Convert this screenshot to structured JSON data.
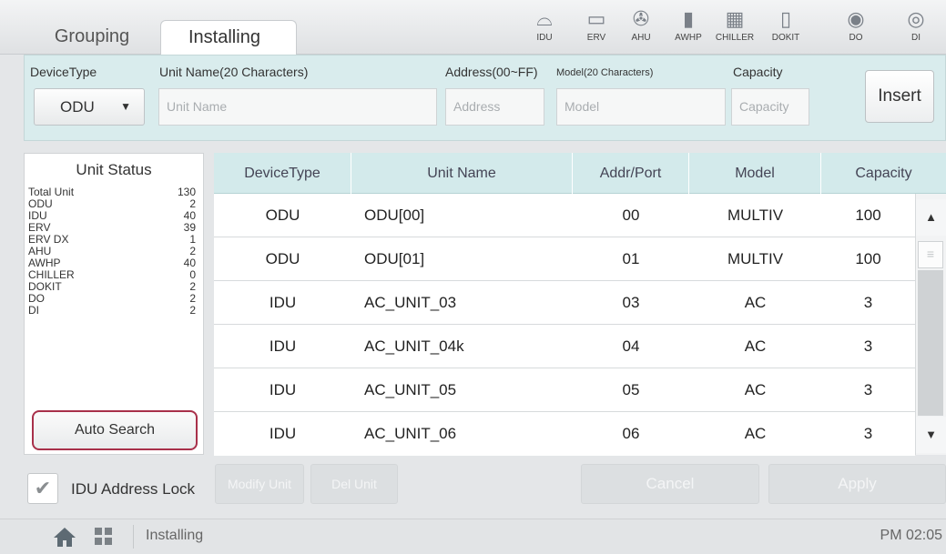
{
  "tabs": [
    {
      "label": "Grouping"
    },
    {
      "label": "Installing"
    }
  ],
  "device_icons": [
    {
      "label": "IDU",
      "icon": "idu-icon"
    },
    {
      "label": "ERV",
      "icon": "erv-icon"
    },
    {
      "label": "AHU",
      "icon": "ahu-icon"
    },
    {
      "label": "AWHP",
      "icon": "awhp-icon"
    },
    {
      "label": "CHILLER",
      "icon": "chiller-icon"
    },
    {
      "label": "DOKIT",
      "icon": "dokit-icon"
    },
    {
      "label": "DO",
      "icon": "do-icon"
    },
    {
      "label": "DI",
      "icon": "di-icon"
    }
  ],
  "form": {
    "device_type_label": "DeviceType",
    "device_type_value": "ODU",
    "unit_name_label": "Unit Name(20 Characters)",
    "unit_name_placeholder": "Unit Name",
    "address_label": "Address(00~FF)",
    "address_placeholder": "Address",
    "model_label": "Model(20 Characters)",
    "model_placeholder": "Model",
    "capacity_label": "Capacity",
    "capacity_placeholder": "Capacity",
    "insert_label": "Insert"
  },
  "unit_status": {
    "title": "Unit Status",
    "rows": [
      {
        "name": "Total Unit",
        "count": "130"
      },
      {
        "name": "ODU",
        "count": "2"
      },
      {
        "name": "IDU",
        "count": "40"
      },
      {
        "name": "ERV",
        "count": "39"
      },
      {
        "name": "ERV DX",
        "count": "1"
      },
      {
        "name": "AHU",
        "count": "2"
      },
      {
        "name": "AWHP",
        "count": "40"
      },
      {
        "name": "CHILLER",
        "count": "0"
      },
      {
        "name": "DOKIT",
        "count": "2"
      },
      {
        "name": "DO",
        "count": "2"
      },
      {
        "name": "DI",
        "count": "2"
      }
    ],
    "auto_search_label": "Auto Search"
  },
  "table": {
    "headers": [
      "DeviceType",
      "Unit Name",
      "Addr/Port",
      "Model",
      "Capacity"
    ],
    "rows": [
      {
        "device": "ODU",
        "name": "ODU[00]",
        "addr": "00",
        "model": "MULTIV",
        "capacity": "100"
      },
      {
        "device": "ODU",
        "name": "ODU[01]",
        "addr": "01",
        "model": "MULTIV",
        "capacity": "100"
      },
      {
        "device": "IDU",
        "name": "AC_UNIT_03",
        "addr": "03",
        "model": "AC",
        "capacity": "3"
      },
      {
        "device": "IDU",
        "name": "AC_UNIT_04k",
        "addr": "04",
        "model": "AC",
        "capacity": "3"
      },
      {
        "device": "IDU",
        "name": "AC_UNIT_05",
        "addr": "05",
        "model": "AC",
        "capacity": "3"
      },
      {
        "device": "IDU",
        "name": "AC_UNIT_06",
        "addr": "06",
        "model": "AC",
        "capacity": "3"
      }
    ]
  },
  "actions": {
    "idu_lock_label": "IDU Address Lock",
    "modify_label": "Modify Unit",
    "delete_label": "Del Unit",
    "cancel_label": "Cancel",
    "apply_label": "Apply"
  },
  "footer": {
    "title": "Installing",
    "time": "PM 02:05"
  },
  "colors": {
    "accent": "#d3eaeb",
    "highlight_border": "#a8304a"
  }
}
